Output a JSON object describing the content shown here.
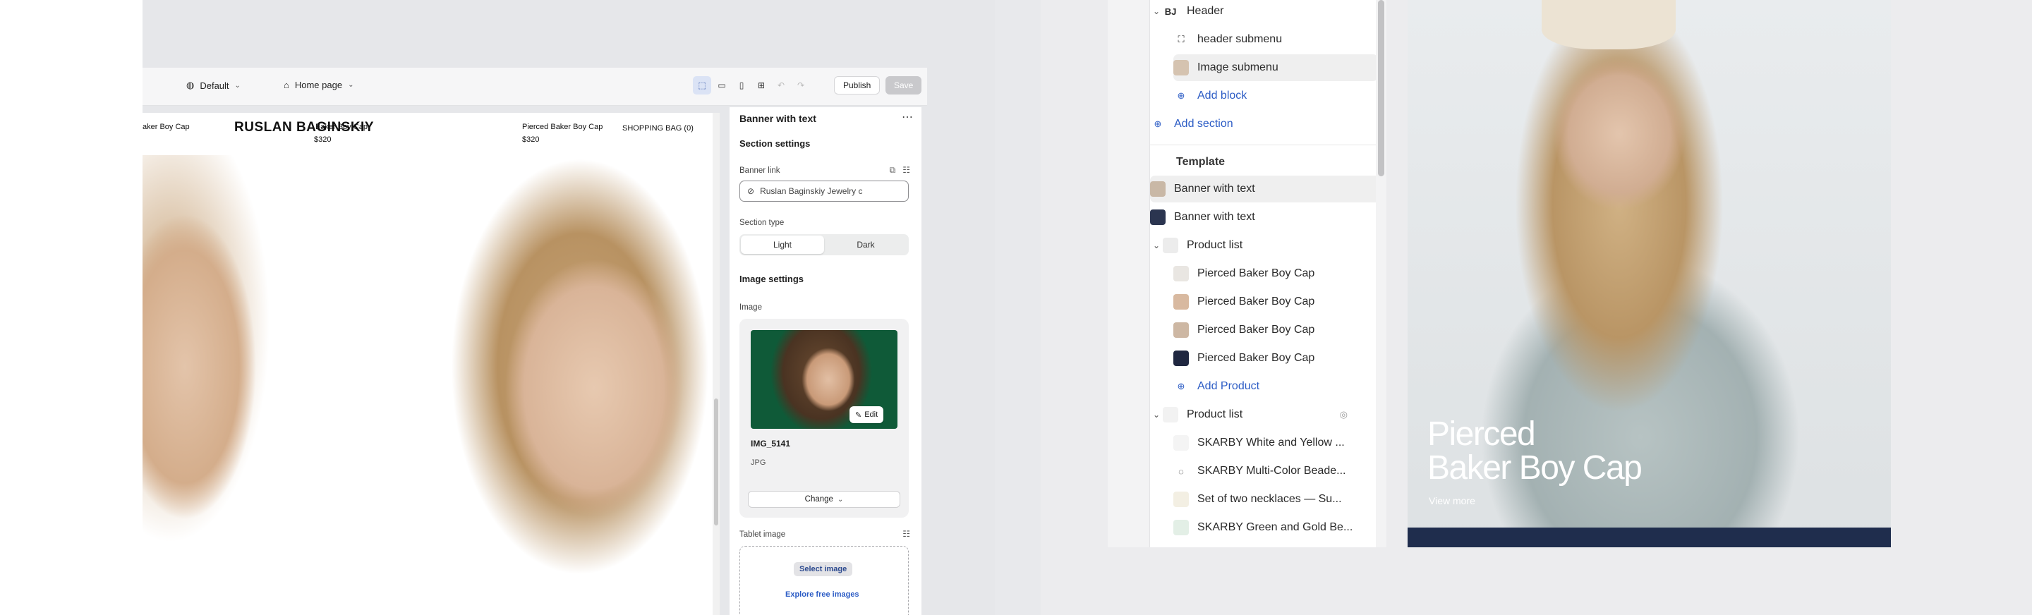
{
  "editor": {
    "theme_label": "Default",
    "page_label": "Home page",
    "publish_label": "Publish",
    "save_label": "Save"
  },
  "storefront": {
    "brand": "RUSLAN BAGINSKIY",
    "nav_items": [
      "aker Boy Cap",
      "Baker Boy Cap",
      "Pierced Baker Boy Cap",
      "SHOPPING BAG (0)"
    ],
    "prices": [
      "$320",
      "$320"
    ]
  },
  "settings": {
    "panel_title": "Banner with text",
    "section_settings": "Section settings",
    "banner_link_label": "Banner link",
    "banner_link_value": "Ruslan Baginskiy Jewelry c",
    "section_type_label": "Section type",
    "section_type_options": [
      "Light",
      "Dark"
    ],
    "section_type_selected": "Light",
    "image_settings": "Image settings",
    "image_label": "Image",
    "image_edit": "Edit",
    "image_name": "IMG_5141",
    "image_type": "JPG",
    "change_label": "Change",
    "tablet_image_label": "Tablet image",
    "select_image": "Select image",
    "explore_free": "Explore free images"
  },
  "tree": {
    "header": "Header",
    "header_items": [
      "header submenu",
      "Image submenu"
    ],
    "add_block": "Add block",
    "add_section": "Add section",
    "template_heading": "Template",
    "template_items": [
      "Banner with text",
      "Banner with text"
    ],
    "product_list_1": "Product list",
    "product_list_1_items": [
      "Pierced Baker Boy Cap",
      "Pierced Baker Boy Cap",
      "Pierced Baker Boy Cap",
      "Pierced Baker Boy Cap"
    ],
    "add_product": "Add Product",
    "product_list_2": "Product list",
    "product_list_2_items": [
      "SKARBY White and Yellow ...",
      "SKARBY Multi-Color Beade...",
      "Set of two necklaces — Su...",
      "SKARBY Green and Gold Be..."
    ]
  },
  "banner": {
    "title_line1": "Pierced",
    "title_line2": "Baker Boy Cap",
    "link": "View more"
  },
  "colors": {
    "accent_blue": "#2c5cc5",
    "selected_row": "#efefef",
    "save_disabled": "#c9c9cc"
  }
}
